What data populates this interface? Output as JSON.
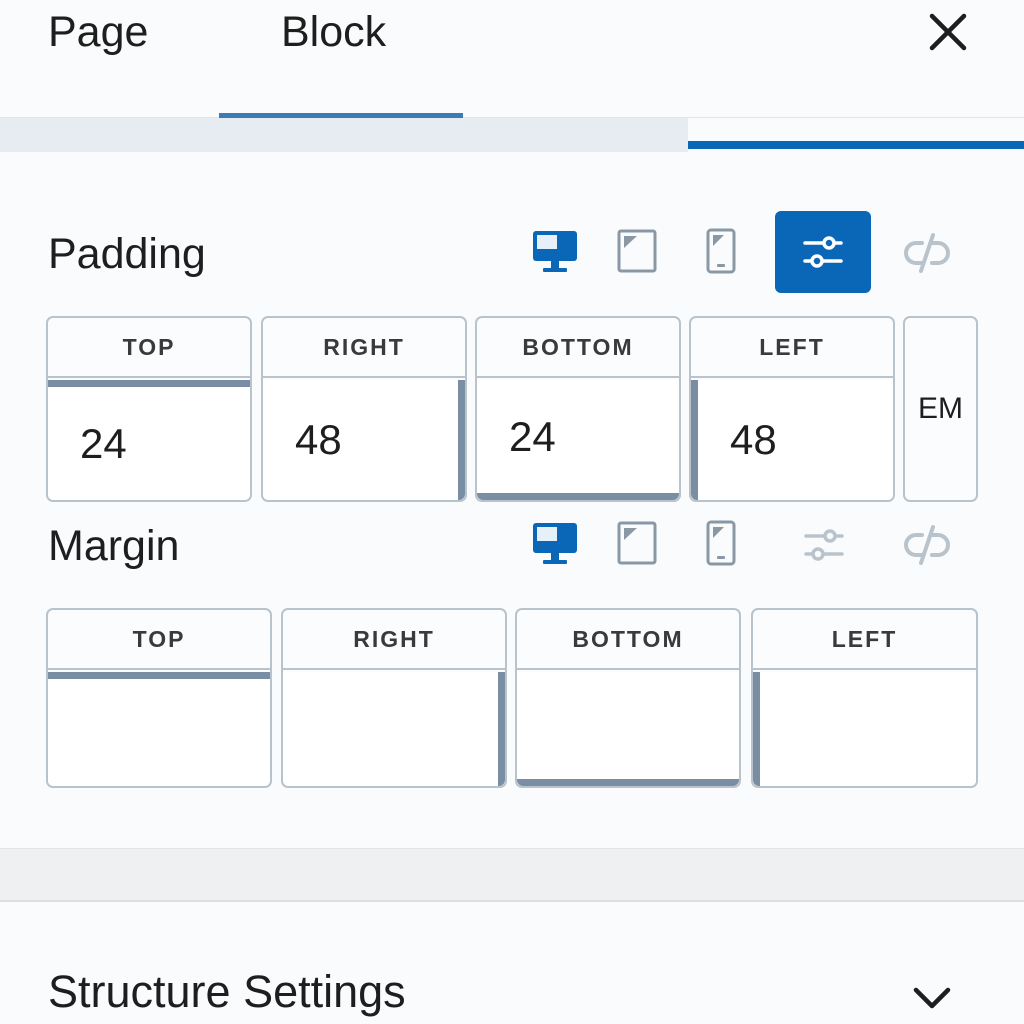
{
  "header": {
    "tabs": [
      {
        "label": "Page"
      },
      {
        "label": "Block"
      }
    ],
    "close_icon": "close-icon"
  },
  "colors": {
    "accent": "#0a66b7",
    "border": "#b9c3cc",
    "side_accent": "#7a8ea3"
  },
  "padding": {
    "label": "Padding",
    "devices": [
      "desktop-icon",
      "tablet-icon",
      "mobile-icon"
    ],
    "controls": [
      "sliders-icon",
      "unlink-icon"
    ],
    "sides": [
      {
        "label": "TOP",
        "value": "24"
      },
      {
        "label": "RIGHT",
        "value": "48"
      },
      {
        "label": "BOTTOM",
        "value": "24"
      },
      {
        "label": "LEFT",
        "value": "48"
      }
    ],
    "unit": "EM"
  },
  "margin": {
    "label": "Margin",
    "devices": [
      "desktop-icon",
      "tablet-icon",
      "mobile-icon"
    ],
    "controls": [
      "sliders-icon",
      "unlink-icon"
    ],
    "sides": [
      {
        "label": "TOP",
        "value": ""
      },
      {
        "label": "RIGHT",
        "value": ""
      },
      {
        "label": "BOTTOM",
        "value": ""
      },
      {
        "label": "LEFT",
        "value": ""
      }
    ]
  },
  "structure": {
    "title": "Structure Settings",
    "toggle_icon": "chevron-down-icon"
  }
}
